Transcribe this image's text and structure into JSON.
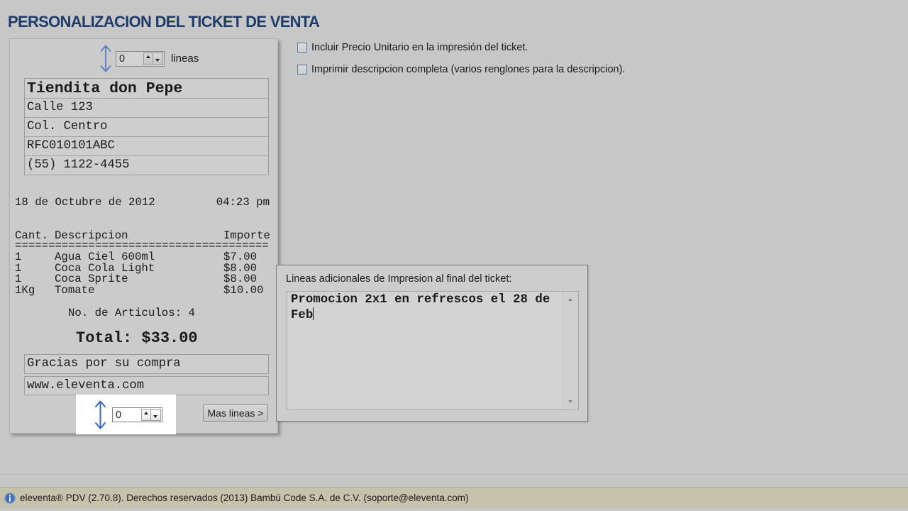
{
  "page": {
    "title": "PERSONALIZACION DEL TICKET DE VENTA"
  },
  "ticket": {
    "header_spinner": {
      "value": "0",
      "unit_label": "lineas",
      "icon": "up-down-arrow-icon"
    },
    "header_lines": [
      "Tiendita don Pepe",
      "Calle 123",
      "Col. Centro",
      "RFC010101ABC",
      "(55) 1122-4455"
    ],
    "date": "18 de Octubre de 2012",
    "time": "04:23 pm",
    "columns": {
      "qty": "Cant.",
      "description": "Descripcion",
      "amount": "Importe"
    },
    "separator": "======================================",
    "items": [
      {
        "qty": "1",
        "description": "Agua Ciel 600ml",
        "amount": "$7.00"
      },
      {
        "qty": "1",
        "description": "Coca Cola Light",
        "amount": "$8.00"
      },
      {
        "qty": "1",
        "description": "Coca Sprite",
        "amount": "$8.00"
      },
      {
        "qty": "1Kg",
        "description": "Tomate",
        "amount": "$10.00"
      }
    ],
    "article_count": "No. de Articulos: 4",
    "total": "Total: $33.00",
    "footer_lines": [
      "Gracias por su compra",
      "www.eleventa.com"
    ],
    "footer_spinner": {
      "value": "0",
      "icon": "up-down-arrow-icon"
    },
    "more_lines_button": "Mas lineas >"
  },
  "options": [
    {
      "label": "Incluir Precio Unitario en la impresión del ticket.",
      "checked": false
    },
    {
      "label": "Imprimir descripcion completa (varios renglones para la descripcion).",
      "checked": false
    }
  ],
  "extra_lines_popup": {
    "label": "Lineas adicionales de Impresion al final del ticket:",
    "text": "Promocion 2x1 en refrescos el 28 de Feb"
  },
  "status_bar": {
    "icon": "info-icon",
    "text": "eleventa® PDV (2.70.8). Derechos reservados (2013) Bambú Code S.A. de C.V. (soporte@eleventa.com)"
  },
  "colors": {
    "title": "#1f3c6a",
    "arrow_icon": "#3a67b5",
    "checkbox_border": "#5b7db3",
    "status_bar_bg": "#c6c3ac",
    "highlight_bg": "#ffffff"
  }
}
